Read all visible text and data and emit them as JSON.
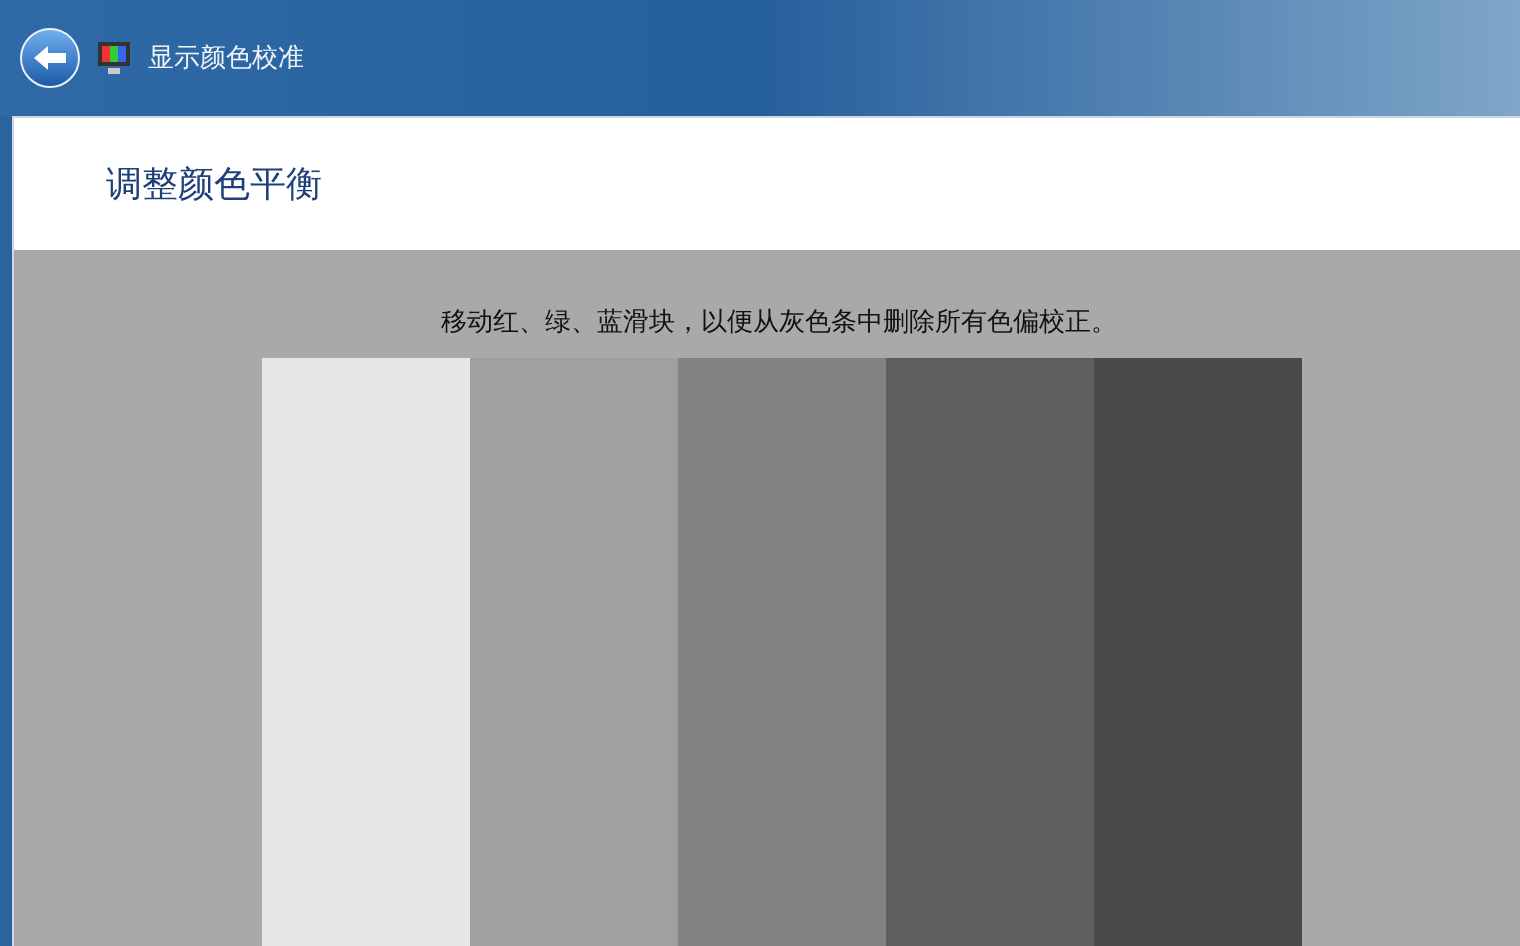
{
  "window": {
    "title": "显示颜色校准"
  },
  "heading": "调整颜色平衡",
  "instruction": "移动红、绿、蓝滑块，以便从灰色条中删除所有色偏校正。",
  "gray_bars": [
    {
      "color": "#e6e6e6"
    },
    {
      "color": "#a0a0a0"
    },
    {
      "color": "#838383"
    },
    {
      "color": "#5e5e5e"
    },
    {
      "color": "#4a4a4a"
    }
  ]
}
